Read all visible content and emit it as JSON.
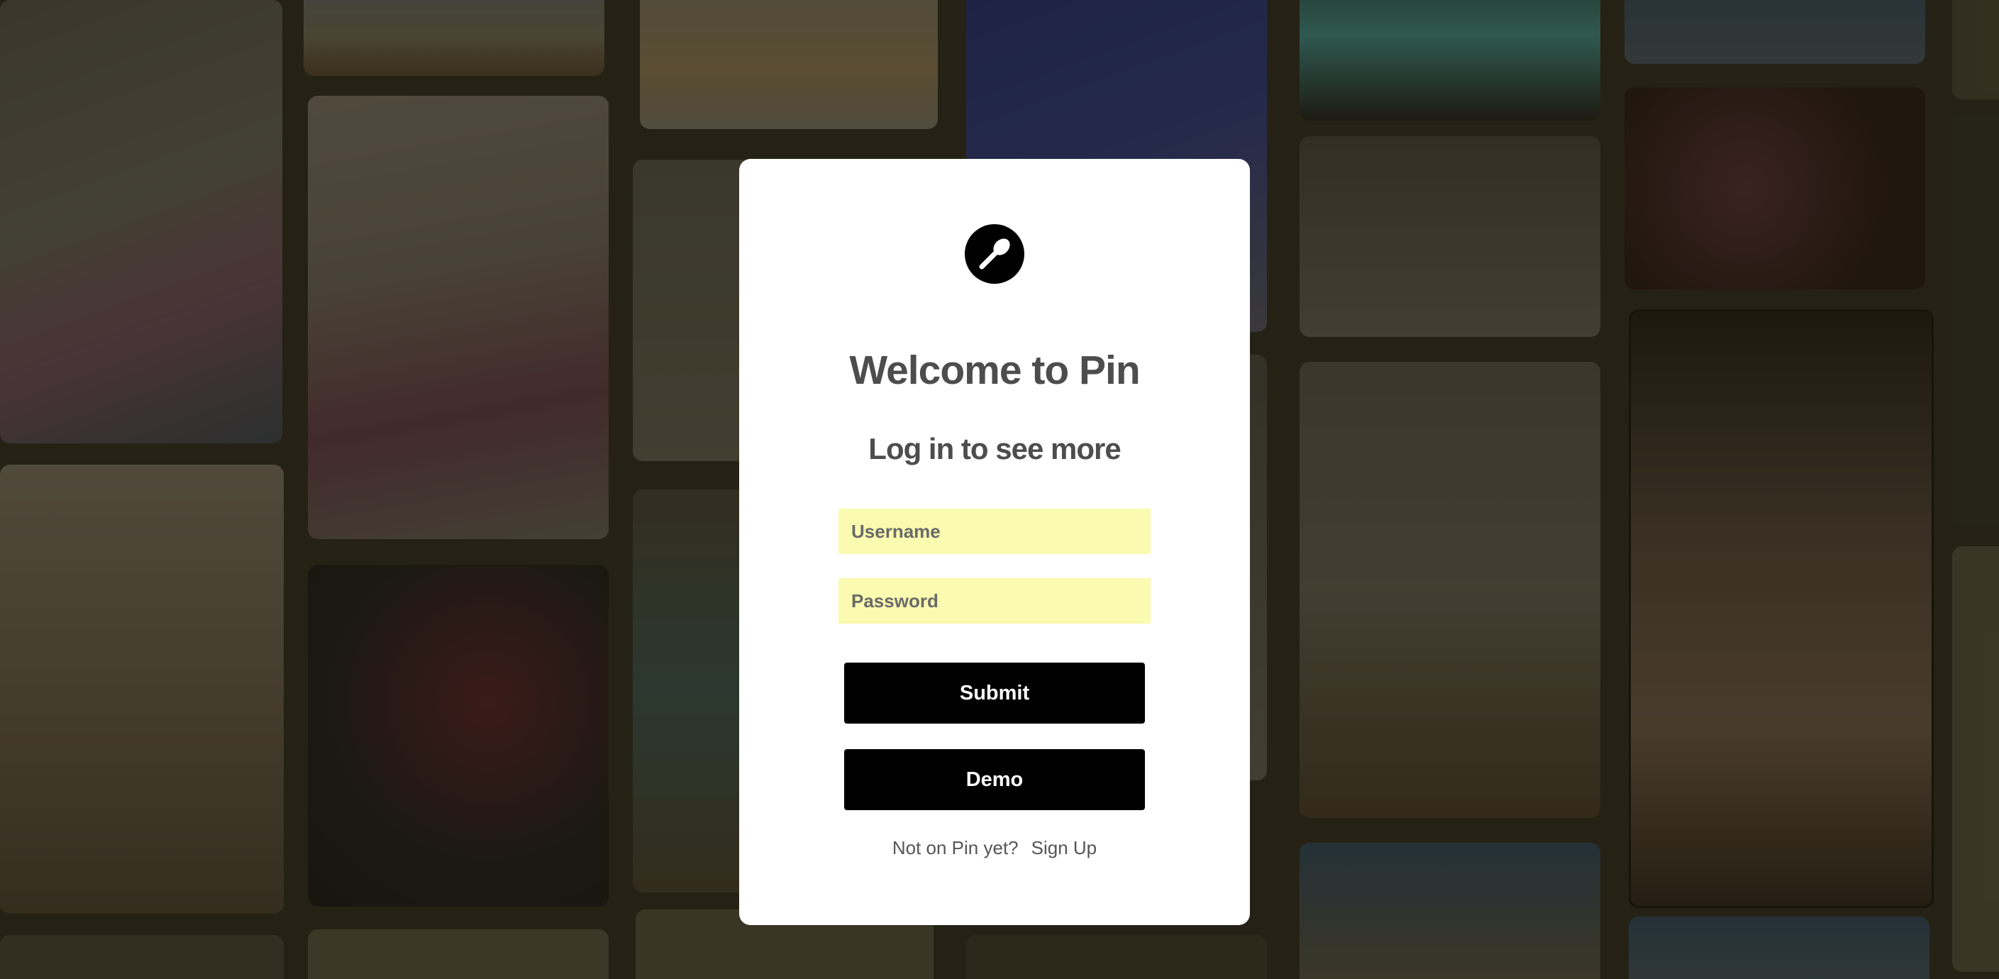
{
  "modal": {
    "logo_icon": "pushpin-icon",
    "title": "Welcome to Pin",
    "subtitle": "Log in to see more",
    "username_placeholder": "Username",
    "password_placeholder": "Password",
    "submit_label": "Submit",
    "demo_label": "Demo",
    "signup_prompt": "Not on Pin yet?",
    "signup_link": "Sign Up"
  },
  "theme": {
    "field_background": "#fafab0",
    "button_background": "#000000",
    "overlay_tint": "#201e0c"
  },
  "background_pins": [
    {
      "name": "pin-ice-cream",
      "colors": [
        "#6e6a64",
        "#8a5a78"
      ]
    },
    {
      "name": "pin-beach-figure",
      "colors": [
        "#7d7560",
        "#5a4630"
      ]
    },
    {
      "name": "pin-fan-sculpture",
      "colors": [
        "#8a8478",
        "#a08860"
      ]
    },
    {
      "name": "pin-bottles",
      "colors": [
        "#1a2a8a",
        "#7a7060"
      ]
    },
    {
      "name": "pin-neon-city",
      "colors": [
        "#1a1a1a",
        "#40a0a0"
      ]
    },
    {
      "name": "pin-sky",
      "colors": [
        "#2a4a6a",
        "#6a5a40"
      ]
    },
    {
      "name": "pin-masked-figure",
      "colors": [
        "#8a8078",
        "#6a3a50"
      ]
    },
    {
      "name": "pin-lips",
      "colors": [
        "#5a5a50",
        "#6a665c"
      ]
    },
    {
      "name": "pin-studio",
      "colors": [
        "#4a4a46",
        "#6a6660"
      ]
    },
    {
      "name": "pin-night-lights",
      "colors": [
        "#201010",
        "#5a2a3a"
      ]
    },
    {
      "name": "pin-caracal",
      "colors": [
        "#7a6a5a",
        "#5a4a3a"
      ]
    },
    {
      "name": "pin-laser-figures",
      "colors": [
        "#0e0e12",
        "#6a1a2a"
      ]
    },
    {
      "name": "pin-living-room",
      "colors": [
        "#4a4238",
        "#3a5a5a"
      ]
    },
    {
      "name": "pin-bathroom",
      "colors": [
        "#6a665c",
        "#4a3a2a"
      ]
    },
    {
      "name": "pin-portrait-flowers",
      "colors": [
        "#1a1410",
        "#7a6050"
      ]
    },
    {
      "name": "pin-mosaic",
      "colors": [
        "#2a4a6a",
        "#6a5a40"
      ]
    },
    {
      "name": "pin-edge",
      "colors": [
        "#2a2820",
        "#4a4430"
      ]
    }
  ]
}
